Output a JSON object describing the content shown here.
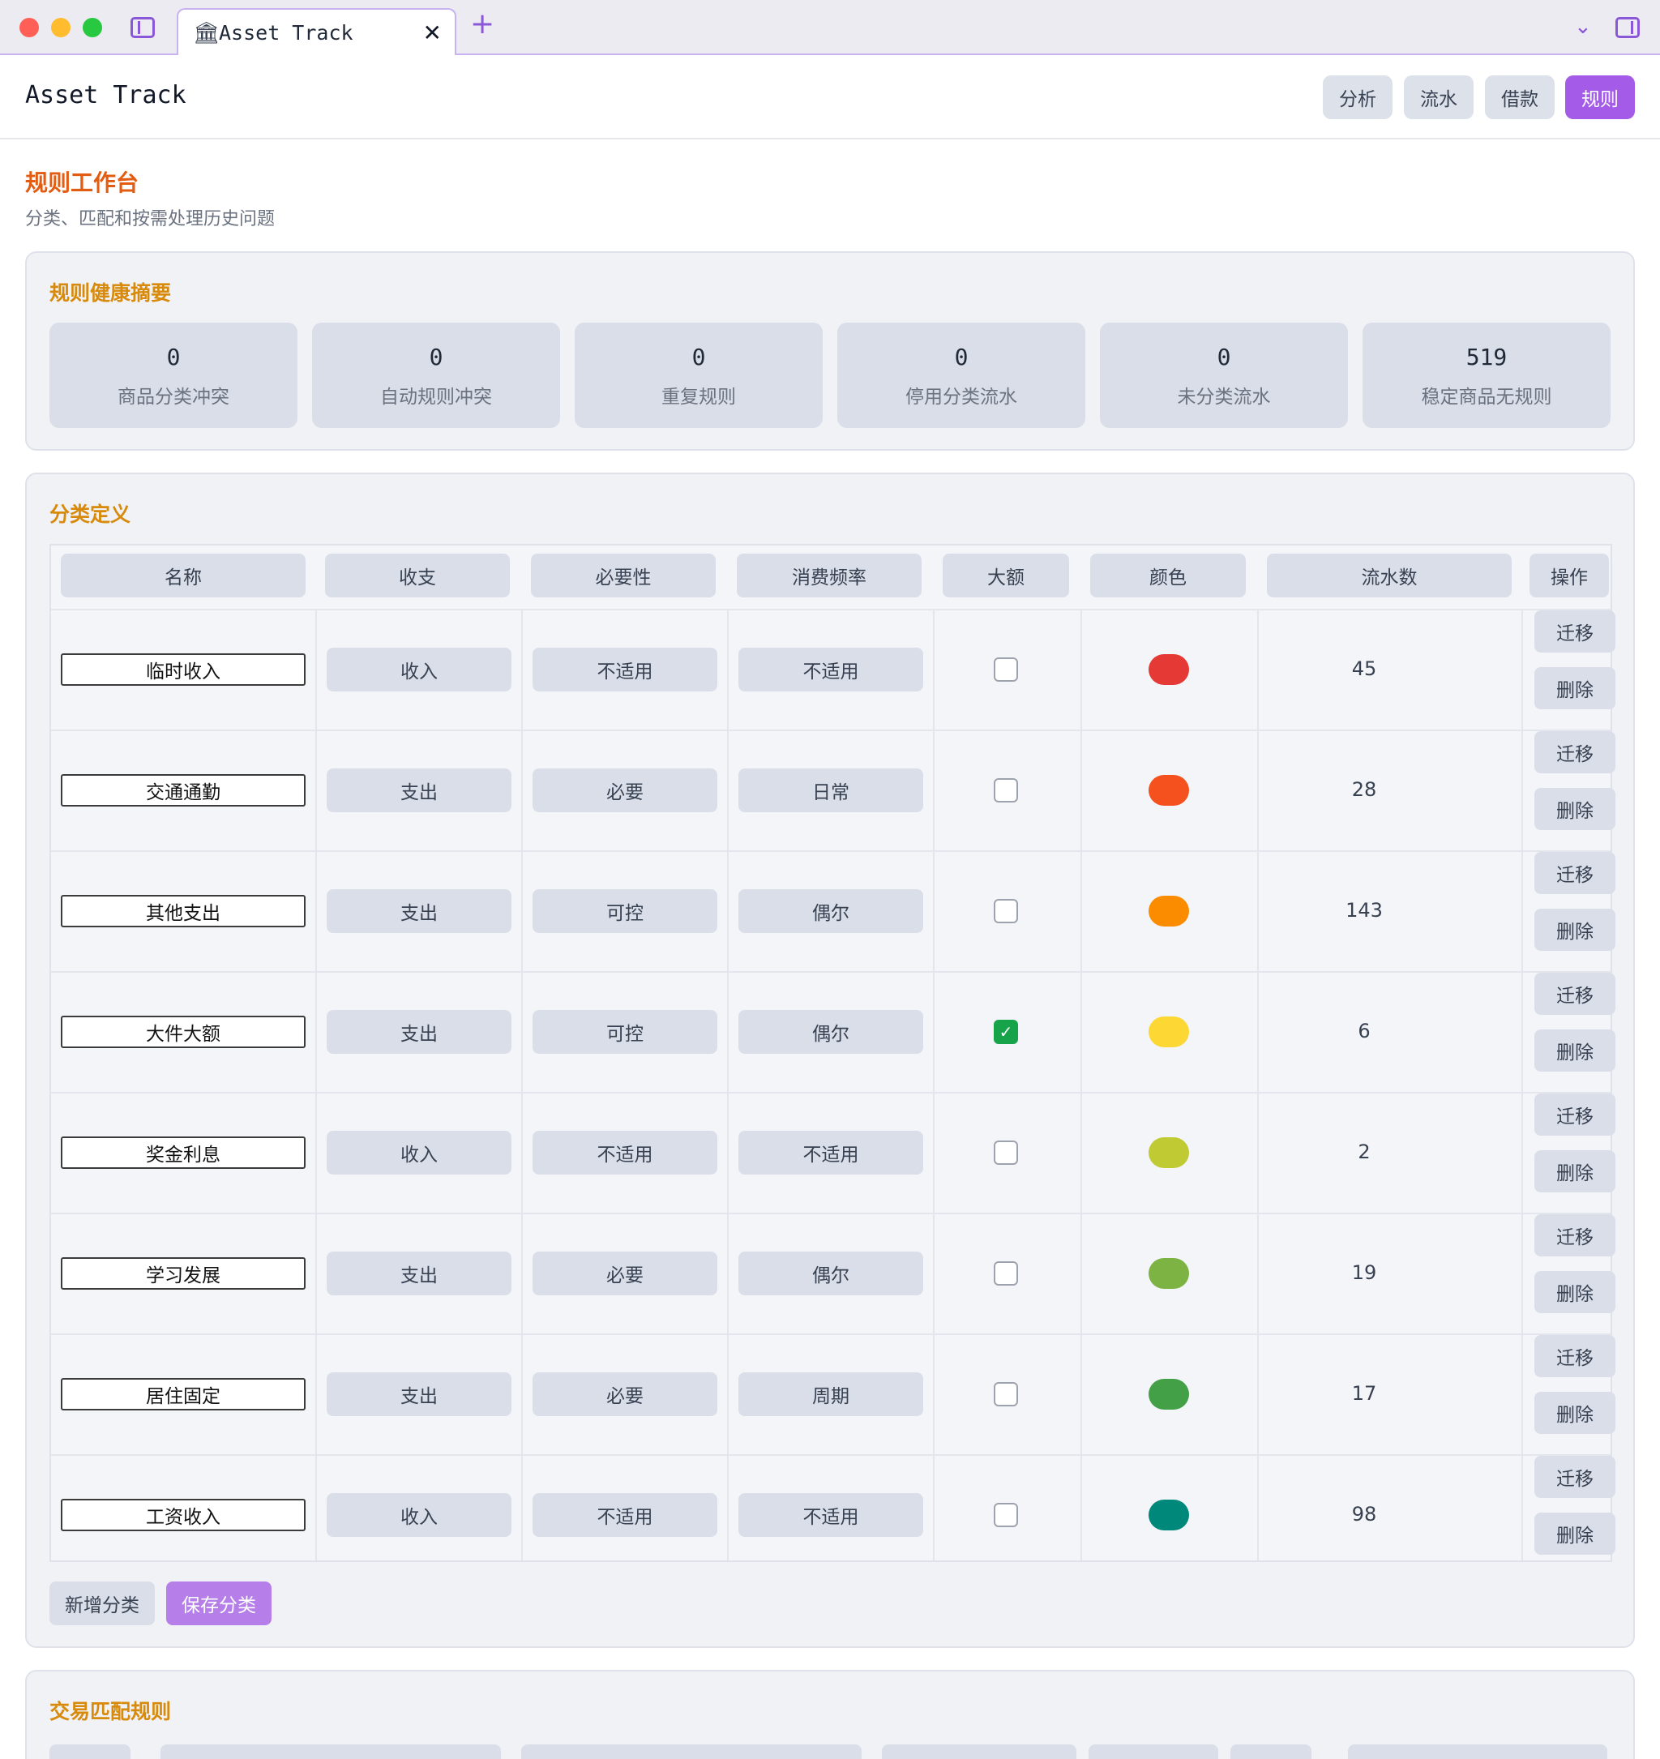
{
  "browser": {
    "tab_title": "Asset Track",
    "tab_icon": "bank-icon",
    "new_tab_label": "+",
    "close_label": "✕"
  },
  "header": {
    "title": "Asset Track",
    "nav": [
      "分析",
      "流水",
      "借款",
      "规则"
    ],
    "active_nav": "规则"
  },
  "page": {
    "title": "规则工作台",
    "subtitle": "分类、匹配和按需处理历史问题"
  },
  "health": {
    "title": "规则健康摘要",
    "stats": [
      {
        "value": "0",
        "label": "商品分类冲突"
      },
      {
        "value": "0",
        "label": "自动规则冲突"
      },
      {
        "value": "0",
        "label": "重复规则"
      },
      {
        "value": "0",
        "label": "停用分类流水"
      },
      {
        "value": "0",
        "label": "未分类流水"
      },
      {
        "value": "519",
        "label": "稳定商品无规则"
      }
    ]
  },
  "categories": {
    "title": "分类定义",
    "columns": [
      "名称",
      "收支",
      "必要性",
      "消费频率",
      "大额",
      "颜色",
      "流水数",
      "操作"
    ],
    "rows": [
      {
        "name": "临时收入",
        "type": "收入",
        "necessity": "不适用",
        "frequency": "不适用",
        "large": false,
        "color": "#e53935",
        "count": "45"
      },
      {
        "name": "交通通勤",
        "type": "支出",
        "necessity": "必要",
        "frequency": "日常",
        "large": false,
        "color": "#f4511e",
        "count": "28"
      },
      {
        "name": "其他支出",
        "type": "支出",
        "necessity": "可控",
        "frequency": "偶尔",
        "large": false,
        "color": "#fb8c00",
        "count": "143"
      },
      {
        "name": "大件大额",
        "type": "支出",
        "necessity": "可控",
        "frequency": "偶尔",
        "large": true,
        "color": "#fdd835",
        "count": "6"
      },
      {
        "name": "奖金利息",
        "type": "收入",
        "necessity": "不适用",
        "frequency": "不适用",
        "large": false,
        "color": "#c0ca33",
        "count": "2"
      },
      {
        "name": "学习发展",
        "type": "支出",
        "necessity": "必要",
        "frequency": "偶尔",
        "large": false,
        "color": "#7cb342",
        "count": "19"
      },
      {
        "name": "居住固定",
        "type": "支出",
        "necessity": "必要",
        "frequency": "周期",
        "large": false,
        "color": "#43a047",
        "count": "17"
      },
      {
        "name": "工资收入",
        "type": "收入",
        "necessity": "不适用",
        "frequency": "不适用",
        "large": false,
        "color": "#00897b",
        "count": "98"
      }
    ],
    "migrate_label": "迁移",
    "delete_label": "删除",
    "add_label": "新增分类",
    "save_label": "保存分类"
  },
  "matching": {
    "title": "交易匹配规则"
  },
  "colors": {
    "accent": "#a45ce8",
    "title_orange": "#e25c12",
    "section_amber": "#d78a0c"
  }
}
